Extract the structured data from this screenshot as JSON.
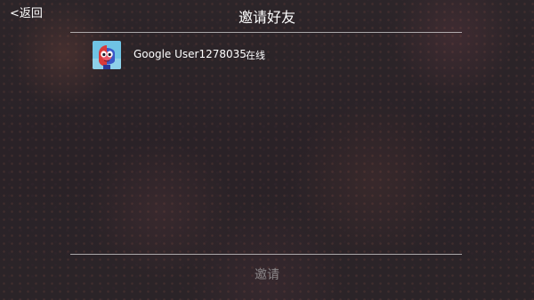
{
  "header": {
    "back_label": "<返回",
    "title": "邀请好友"
  },
  "friends": [
    {
      "name": "Google User1278035",
      "status": "在线",
      "avatar_icon": "red-blue-masked-face-avatar"
    }
  ],
  "footer": {
    "invite_label": "邀请"
  },
  "colors": {
    "text": "#ffffff",
    "disabled_text": "#8b8789",
    "divider": "#b8b4b6",
    "background": "#2b2428"
  }
}
